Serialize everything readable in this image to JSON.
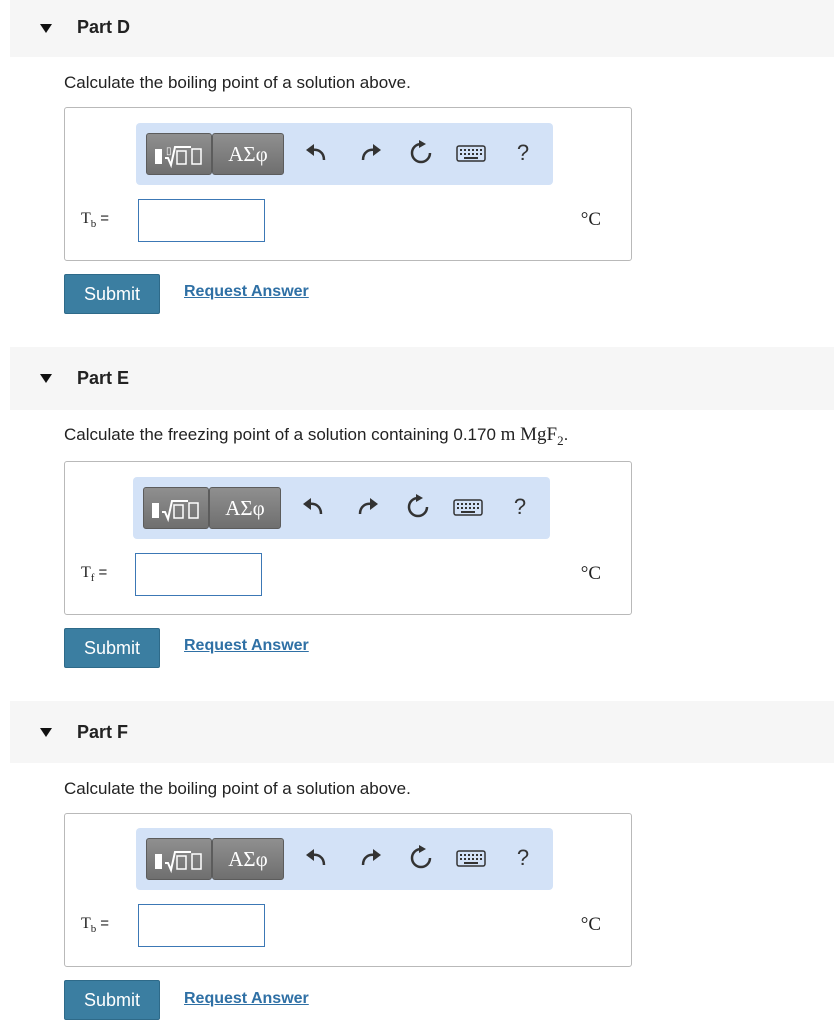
{
  "parts": [
    {
      "title": "Part D",
      "prompt": "Calculate the boiling point of a solution above.",
      "variable": {
        "symbol": "T",
        "subscript": "b",
        "equals": "="
      },
      "unit": "°C",
      "submit_label": "Submit",
      "request_label": "Request Answer"
    },
    {
      "title": "Part E",
      "prompt_prefix": "Calculate the freezing point of a solution containing 0.170 ",
      "prompt_unit": "m",
      "prompt_formula": "MgF",
      "prompt_formula_sub": "2",
      "prompt_suffix": ".",
      "variable": {
        "symbol": "T",
        "subscript": "f",
        "equals": "="
      },
      "unit": "°C",
      "submit_label": "Submit",
      "request_label": "Request Answer"
    },
    {
      "title": "Part F",
      "prompt": "Calculate the boiling point of a solution above.",
      "variable": {
        "symbol": "T",
        "subscript": "b",
        "equals": "="
      },
      "unit": "°C",
      "submit_label": "Submit",
      "request_label": "Request Answer"
    }
  ],
  "toolbar": {
    "greek_label": "ΑΣφ",
    "help_label": "?",
    "icons": [
      "templates-icon",
      "greek-letters-icon",
      "undo-icon",
      "redo-icon",
      "reset-icon",
      "keyboard-icon",
      "help-icon"
    ]
  },
  "colors": {
    "header_bg": "#f6f6f6",
    "toolbar_bg": "#d3e2f7",
    "submit_bg": "#3b7ea1",
    "link": "#2f70a5",
    "input_border": "#3c78b5"
  }
}
